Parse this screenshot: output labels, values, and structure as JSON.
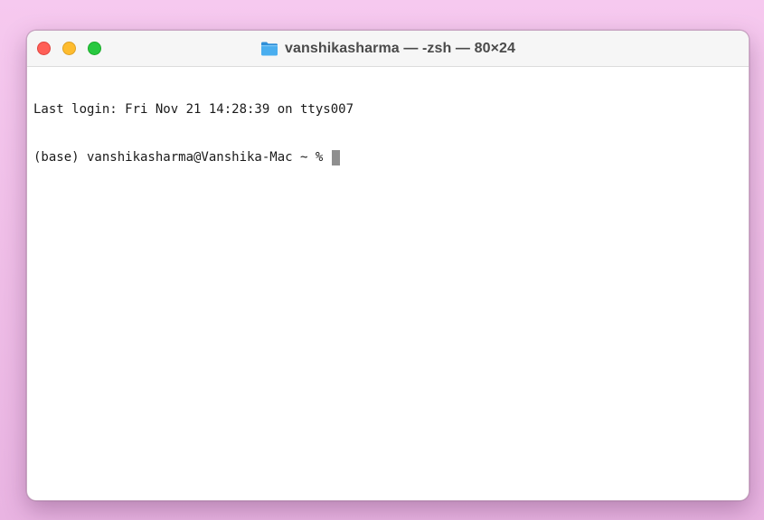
{
  "window": {
    "title": "vanshikasharma — -zsh — 80×24",
    "folder_icon": "folder-icon",
    "controls": {
      "close": "close-button",
      "minimize": "minimize-button",
      "zoom": "zoom-button"
    }
  },
  "terminal": {
    "lines": [
      "Last login: Fri Nov 21 14:28:39 on ttys007",
      "(base) vanshikasharma@Vanshika-Mac ~ % "
    ]
  },
  "colors": {
    "desktop": "#f2c4eb",
    "close": "#ff5f57",
    "minimize": "#febc2e",
    "zoom": "#28c840",
    "folder": "#3fa3e8",
    "cursor": "#8f8f8f"
  }
}
